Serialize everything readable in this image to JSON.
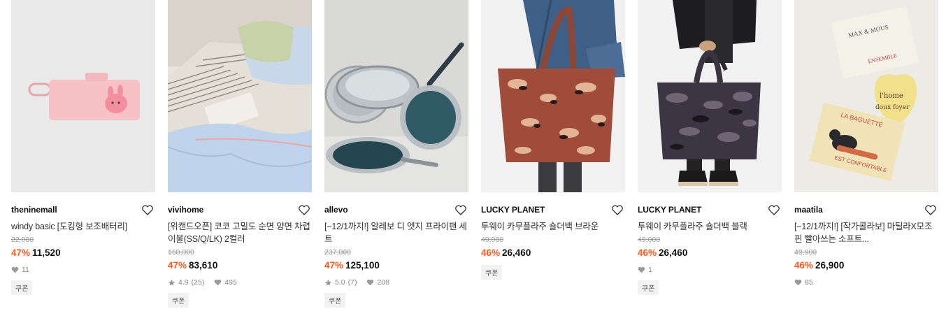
{
  "products": [
    {
      "brand": "theninemall",
      "title": "windy basic [도킹형 보조배터리]",
      "original_price": "22,000",
      "discount": "47%",
      "price": "11,520",
      "rating": "",
      "reviews": "",
      "likes": "11",
      "coupon": "쿠폰"
    },
    {
      "brand": "vivihome",
      "title": "[위캔드오픈] 코코 고밀도 순면 양면 차렵이불(SS/Q/LK) 2컬러",
      "original_price": "160,000",
      "discount": "47%",
      "price": "83,610",
      "rating": "4.9",
      "reviews": "(25)",
      "likes": "495",
      "coupon": "쿠폰"
    },
    {
      "brand": "allevo",
      "title": "[~12/1까지!] 알레보 디 엣지 프라이팬 세트",
      "original_price": "237,000",
      "discount": "47%",
      "price": "125,100",
      "rating": "5.0",
      "reviews": "(7)",
      "likes": "208",
      "coupon": "쿠폰"
    },
    {
      "brand": "LUCKY PLANET",
      "title": "투웨이 카무플라주 숄더백 브라운",
      "original_price": "49,000",
      "discount": "46%",
      "price": "26,460",
      "rating": "",
      "reviews": "",
      "likes": "",
      "coupon": "쿠폰"
    },
    {
      "brand": "LUCKY PLANET",
      "title": "투웨이 카무플라주 숄더백 블랙",
      "original_price": "49,000",
      "discount": "46%",
      "price": "26,460",
      "rating": "",
      "reviews": "",
      "likes": "1",
      "coupon": "쿠폰"
    },
    {
      "brand": "maatila",
      "title": "[~12/1까지!] [작가콜라보] 마틸라X모조핀 빨아쓰는 소프트...",
      "original_price": "49,900",
      "discount": "46%",
      "price": "26,900",
      "rating": "",
      "reviews": "",
      "likes": "85",
      "coupon": ""
    }
  ],
  "poster_text": {
    "line1": "MAX & MOUS",
    "line2": "ENSEMBLE",
    "line3": "l'home",
    "line4": "doux foyer",
    "line5": "LA BAGUETTE",
    "line6": "EST CONFORTABLE"
  },
  "colors": {
    "discount": "#ff5a1f",
    "text": "#222222",
    "muted": "#999999"
  }
}
